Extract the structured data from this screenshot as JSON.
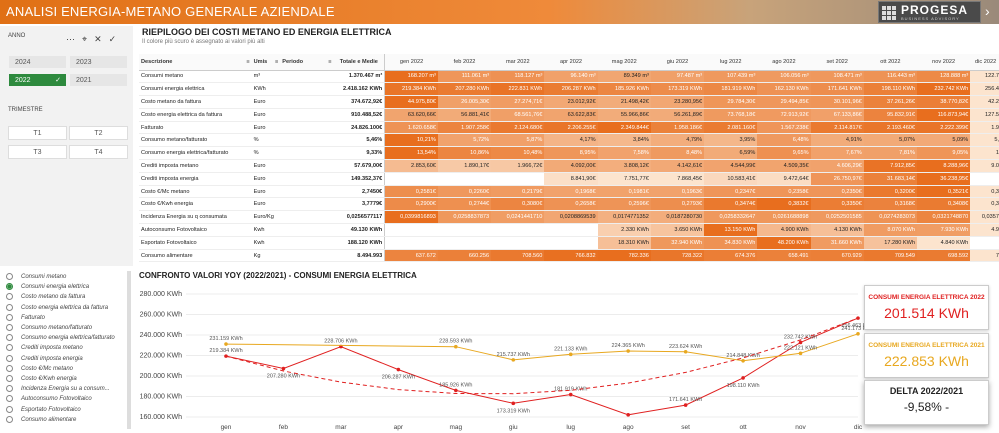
{
  "app": {
    "title": "ANALISI ENERGIA-METANO GENERALE AZIENDALE",
    "logo_text": "PROGESA",
    "logo_sub": "BUSINESS ADVISORY"
  },
  "filters": {
    "anno_label": "ANNO",
    "years": [
      "2024",
      "2023",
      "2022",
      "2021"
    ],
    "selected_year": "2022",
    "trimestre_label": "TRIMESTRE",
    "quarters": [
      "T1",
      "T2",
      "T3",
      "T4"
    ]
  },
  "report": {
    "title": "RIEPILOGO DEI COSTI METANO ED ENERGIA ELETTRICA",
    "subtitle": "Il colore più scuro è assegnato ai valori più alti",
    "headers": {
      "descrizione": "Descrizione",
      "umis": "Umis",
      "periodo": "Periodo",
      "totale": "Totale e Medie"
    },
    "months": [
      "gen 2022",
      "feb 2022",
      "mar 2022",
      "apr 2022",
      "mag 2022",
      "giu 2022",
      "lug 2022",
      "ago 2022",
      "set 2022",
      "ott 2022",
      "nov 2022",
      "dic 2022"
    ],
    "rows": [
      {
        "desc": "Consumi metano",
        "umis": "m³",
        "tot": "1.370.467 m³",
        "vals": [
          "168.207 m³",
          "111.061 m³",
          "118.127 m³",
          "96.140 m³",
          "89.349 m³",
          "97.487 m³",
          "107.439 m³",
          "106.056 m³",
          "108.471 m³",
          "116.443 m³",
          "128.888 m³",
          "122.7"
        ]
      },
      {
        "desc": "Consumi energia elettrica",
        "umis": "KWh",
        "tot": "2.418.162 KWh",
        "vals": [
          "219.384 KWh",
          "207.280 KWh",
          "222.831 KWh",
          "206.287 KWh",
          "185.926 KWh",
          "173.319 KWh",
          "181.919 KWh",
          "162.130 KWh",
          "171.641 KWh",
          "198.110 KWh",
          "232.742 KWh",
          "256.4"
        ]
      },
      {
        "desc": "Costo metano da fattura",
        "umis": "Euro",
        "tot": "374.672,92€",
        "vals": [
          "44.975,80€",
          "26.005,30€",
          "27.274,71€",
          "23.012,92€",
          "21.498,42€",
          "23.280,95€",
          "29.784,30€",
          "29.494,85€",
          "30.101,96€",
          "37.261,26€",
          "38.770,82€",
          "42.2"
        ]
      },
      {
        "desc": "Costo energia elettrica da fattura",
        "umis": "Euro",
        "tot": "910.488,52€",
        "vals": [
          "63.620,66€",
          "56.881,41€",
          "68.561,76€",
          "63.622,83€",
          "55.966,86€",
          "56.261,89€",
          "73.768,18€",
          "72.913,92€",
          "67.133,86€",
          "95.832,91€",
          "116.873,94€",
          "127.5"
        ]
      },
      {
        "desc": "Fatturato",
        "umis": "Euro",
        "tot": "24.826.100€",
        "vals": [
          "1.620.658€",
          "1.907.258€",
          "2.124.680€",
          "2.206.255€",
          "2.349.844€",
          "1.958.186€",
          "2.081.160€",
          "1.567.238€",
          "2.114.817€",
          "2.193.460€",
          "2.222.399€",
          "1.9"
        ]
      },
      {
        "desc": "Consumo metano/fatturato",
        "umis": "%",
        "tot": "5,46%",
        "vals": [
          "10,21%",
          "5,72%",
          "5,87%",
          "4,17%",
          "3,84%",
          "4,79%",
          "3,95%",
          "6,48%",
          "4,91%",
          "5,07%",
          "5,09%",
          "5,"
        ]
      },
      {
        "desc": "Consumo energia elettrica/fatturato",
        "umis": "%",
        "tot": "9,33%",
        "vals": [
          "13,54%",
          "10,86%",
          "10,48%",
          "8,95%",
          "7,58%",
          "8,48%",
          "6,59%",
          "9,65%",
          "7,67%",
          "7,81%",
          "9,05%",
          "1"
        ]
      },
      {
        "desc": "Crediti imposta metano",
        "umis": "Euro",
        "tot": "57.679,00€",
        "vals": [
          "2.853,60€",
          "1.890,17€",
          "1.966,72€",
          "4.092,00€",
          "3.808,12€",
          "4.142,61€",
          "4.544,99€",
          "4.509,35€",
          "4.606,29€",
          "7.912,85€",
          "8.288,96€",
          "9.0"
        ]
      },
      {
        "desc": "Crediti imposta energia",
        "umis": "Euro",
        "tot": "149.352,37€",
        "vals": [
          "",
          "",
          "",
          "8.841,90€",
          "7.751,77€",
          "7.868,45€",
          "10.583,41€",
          "9.472,64€",
          "26.750,97€",
          "31.683,14€",
          "36.238,95€",
          ""
        ]
      },
      {
        "desc": "Costo €/Mc metano",
        "umis": "Euro",
        "tot": "2,7450€",
        "vals": [
          "0,2581€",
          "0,2260€",
          "0,2179€",
          "0,1968€",
          "0,1981€",
          "0,1963€",
          "0,2347€",
          "0,2358€",
          "0,2350€",
          "0,3200€",
          "0,3521€",
          "0,3"
        ]
      },
      {
        "desc": "Costo €/Kwh energia",
        "umis": "Euro",
        "tot": "3,7779€",
        "vals": [
          "0,2900€",
          "0,2744€",
          "0,3080€",
          "0,2658€",
          "0,2596€",
          "0,2793€",
          "0,3474€",
          "0,3832€",
          "0,3350€",
          "0,3168€",
          "0,3408€",
          "0,3"
        ]
      },
      {
        "desc": "Incidenza Energia su q consumata",
        "umis": "Euro/Kg",
        "tot": "0,0256577117",
        "vals": [
          "0,0399816893",
          "0,0258837873",
          "0,0241441710",
          "0,0208869539",
          "0,0174771352",
          "0,0187280730",
          "0,0258332647",
          "0,0261688898",
          "0,0252501585",
          "0,0274283073",
          "0,0321748870",
          "0,0357"
        ]
      },
      {
        "desc": "Autoconsumo Fotovoltaico",
        "umis": "Kwh",
        "tot": "49.130 KWh",
        "vals": [
          "",
          "",
          "",
          "",
          "2.330 KWh",
          "3.650 KWh",
          "13.150 KWh",
          "4.900 KWh",
          "4.130 KWh",
          "8.070 KWh",
          "7.930 KWh",
          "4.9"
        ]
      },
      {
        "desc": "Esportato Fotovoltaico",
        "umis": "Kwh",
        "tot": "188.120 KWh",
        "vals": [
          "",
          "",
          "",
          "",
          "18.310 KWh",
          "32.940 KWh",
          "34.830 KWh",
          "48.200 KWh",
          "31.660 KWh",
          "17.280 KWh",
          "4.840 KWh",
          ""
        ]
      },
      {
        "desc": "Consumo alimentare",
        "umis": "Kg",
        "tot": "8.494.993",
        "vals": [
          "637.672",
          "660.256",
          "708.560",
          "766.832",
          "782.336",
          "728.322",
          "674.376",
          "658.491",
          "670.929",
          "709.549",
          "698.592",
          "7"
        ]
      }
    ]
  },
  "metrics_list": {
    "items": [
      "Consumi metano",
      "Consumi energia elettrica",
      "Costo metano da fattura",
      "Costo energia elettrica da fattura",
      "Fatturato",
      "Consumo metano/fatturato",
      "Consumo energia elettrica/fatturato",
      "Crediti imposta metano",
      "Crediti imposta energia",
      "Costo €/Mc metano",
      "Costo €/Kwh energia",
      "Incidenza Energia su a consum...",
      "Autoconsumo Fotovoltaico",
      "Esportato Fotovoltaico",
      "Consumo alimentare"
    ],
    "selected": 1
  },
  "chart_title": "CONFRONTO VALORI YOY (2022/2021) - CONSUMI ENERGIA ELETTRICA",
  "kpis": {
    "k2022_label": "CONSUMI ENERGIA ELETTRICA 2022",
    "k2022_value": "201.514 KWh",
    "k2022_color": "#e02020",
    "k2021_label": "CONSUMI ENERGIA ELETTRICA 2021",
    "k2021_value": "222.853 KWh",
    "k2021_color": "#e8a820",
    "delta_label": "DELTA 2022/2021",
    "delta_value": "-9,58% -"
  },
  "chart_data": {
    "type": "line",
    "categories": [
      "gen",
      "feb",
      "mar",
      "apr",
      "mag",
      "giu",
      "lug",
      "ago",
      "set",
      "ott",
      "nov",
      "dic"
    ],
    "ylim": [
      160000,
      280000
    ],
    "yticks": [
      "160.000 KWh",
      "180.000 KWh",
      "200.000 KWh",
      "220.000 KWh",
      "240.000 KWh",
      "260.000 KWh",
      "280.000 KWh"
    ],
    "series": [
      {
        "name": "2022",
        "color": "#e02020",
        "values": [
          219384,
          207280,
          228706,
          206287,
          185926,
          173319,
          181919,
          162130,
          171641,
          198110,
          232742,
          256463
        ],
        "labels": [
          "219.384 KWh",
          "207.280 KWh",
          "228.706 KWh",
          "206.287 KWh",
          "185.926 KWh",
          "173.319 KWh",
          "181.919 KWh",
          "",
          "171.641 KWh",
          "198.110 KWh",
          "232.742 KWh",
          "256.463 KWh"
        ]
      },
      {
        "name": "2021",
        "color": "#e8a820",
        "values": [
          231159,
          null,
          null,
          null,
          228593,
          215737,
          221133,
          224365,
          223624,
          214848,
          222121,
          241173
        ],
        "labels": [
          "231.159 KWh",
          "",
          "",
          "",
          "228.593 KWh",
          "215.737 KWh",
          "221.133 KWh",
          "224.365 KWh",
          "223.624 KWh",
          "214.848 KWh",
          "222.121 KWh",
          "241.173 KWh"
        ]
      }
    ]
  }
}
